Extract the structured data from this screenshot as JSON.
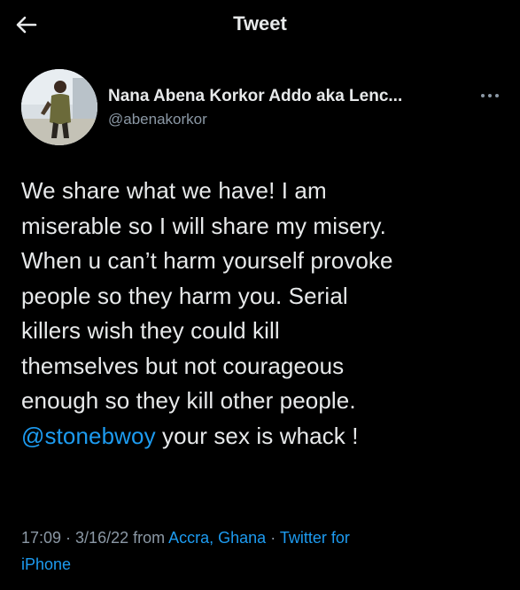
{
  "topbar": {
    "title": "Tweet",
    "back_icon": "arrow-left-icon"
  },
  "author": {
    "display_name": "Nana Abena Korkor Addo aka Lenc...",
    "handle": "@abenakorkor",
    "more_icon": "more-horizontal-icon"
  },
  "tweet": {
    "lines": [
      "We share what we have! I am",
      "miserable so I will share my misery.",
      "When u can’t harm yourself provoke",
      "people so they harm you. Serial",
      "killers wish they could kill",
      "themselves but not courageous",
      "enough so they kill other people."
    ],
    "mention": "@stonebwoy",
    "last_line_rest": " your sex is whack !"
  },
  "meta": {
    "time": "17:09",
    "sep1": " · ",
    "date": "3/16/22",
    "from": " from ",
    "location": "Accra, Ghana",
    "sep2": " · ",
    "source_part1": "Twitter for",
    "source_part2": "iPhone"
  },
  "colors": {
    "background": "#000000",
    "text": "#e7e9ea",
    "secondary": "#8b98a5",
    "link": "#1d9bf0"
  }
}
